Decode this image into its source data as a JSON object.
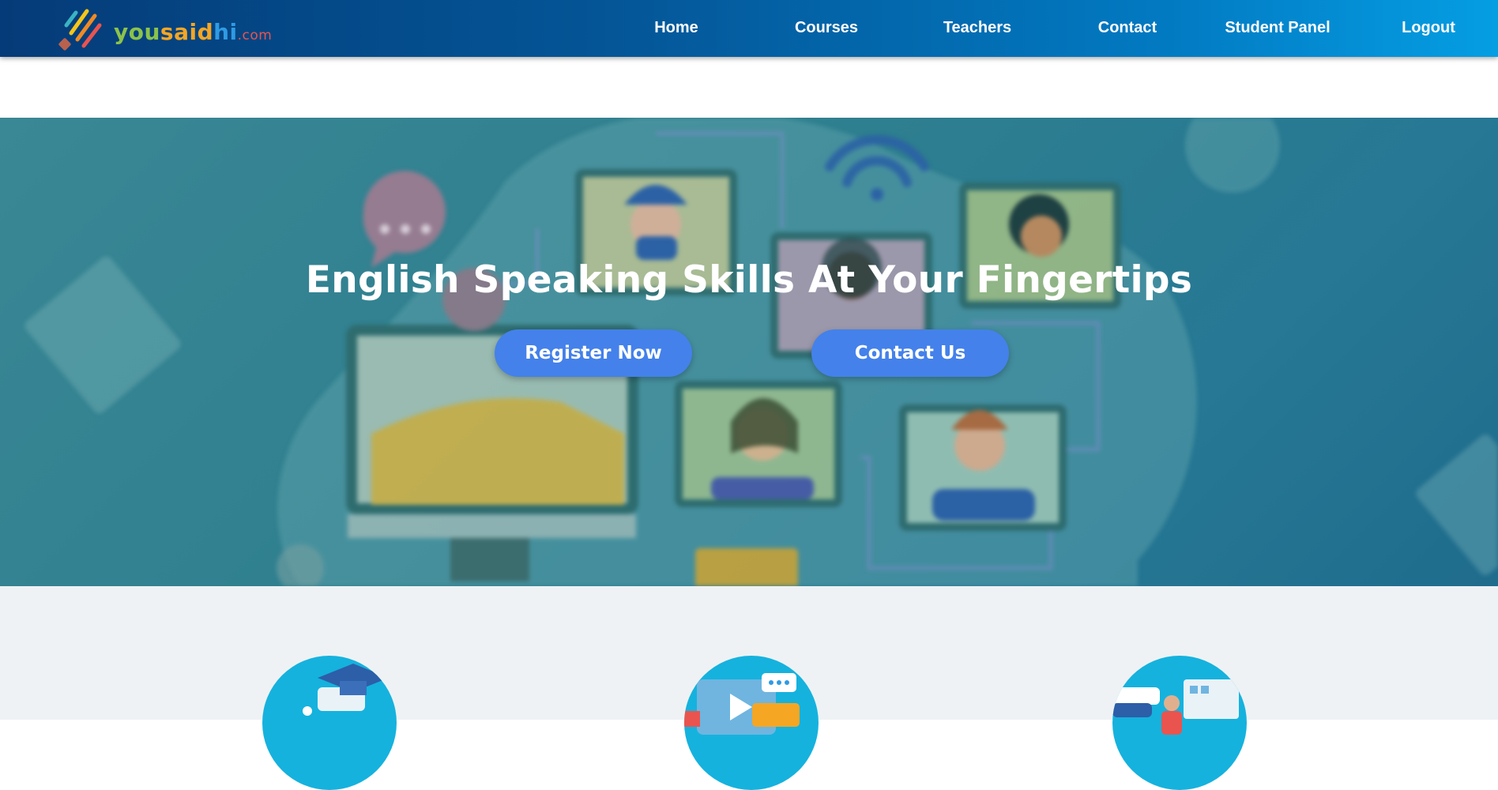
{
  "brand": {
    "logo_parts": [
      "you",
      "said",
      "hi",
      ".com"
    ],
    "colors": {
      "green": "#8bc34a",
      "orange": "#f5a623",
      "blue": "#2f9be3",
      "red": "#e9544f"
    }
  },
  "nav": {
    "items": [
      {
        "label": "Home"
      },
      {
        "label": "Courses"
      },
      {
        "label": "Teachers"
      },
      {
        "label": "Contact"
      },
      {
        "label": "Student Panel"
      },
      {
        "label": "Logout"
      }
    ]
  },
  "hero": {
    "title": "English Speaking Skills At Your Fingertips",
    "register_label": "Register Now",
    "contact_label": "Contact Us",
    "accent": "#4481ea"
  },
  "features": {
    "icons": [
      "graduation-cap-icon",
      "video-chat-icon",
      "online-classroom-icon"
    ]
  }
}
